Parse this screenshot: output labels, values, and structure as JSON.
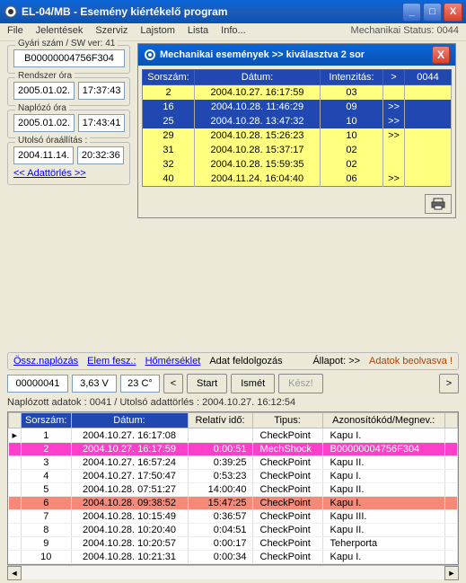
{
  "window": {
    "title": "EL-04/MB - Esemény kiértékelő program"
  },
  "menu": {
    "file": "File",
    "jelentesek": "Jelentések",
    "szerviz": "Szerviz",
    "lajstom": "Lajstom",
    "lista": "Lista",
    "info": "Info...",
    "status": "Mechanikai Status:  0044"
  },
  "left": {
    "gyari_legend": "Gyári szám / SW ver: 41",
    "gyari_value": "B00000004756F304",
    "rendszer_legend": "Rendszer óra",
    "rendszer_date": "2005.01.02.",
    "rendszer_time": "17:37:43",
    "naplozo_legend": "Naplózó óra",
    "naplozo_date": "2005.01.02.",
    "naplozo_time": "17:43:41",
    "utolso_legend": "Utolsó óraállítás :",
    "utolso_date": "2004.11.14.",
    "utolso_time": "20:32:36",
    "adattorles": "<< Adattörlés >>"
  },
  "popup": {
    "title": "Mechanikai események   >> kiválasztva 2 sor",
    "cols": {
      "sorszam": "Sorszám:",
      "datum": "Dátum:",
      "intenzitas": "Intenzitás:",
      "gt": ">",
      "code": "0044"
    },
    "rows": [
      {
        "s": "2",
        "d": "2004.10.27. 16:17:59",
        "i": "03",
        "g": ""
      },
      {
        "s": "16",
        "d": "2004.10.28. 11:46:29",
        "i": "09",
        "g": ">>"
      },
      {
        "s": "25",
        "d": "2004.10.28. 13:47:32",
        "i": "10",
        "g": ">>"
      },
      {
        "s": "29",
        "d": "2004.10.28. 15:26:23",
        "i": "10",
        "g": ">>"
      },
      {
        "s": "31",
        "d": "2004.10.28. 15:37:17",
        "i": "02",
        "g": ""
      },
      {
        "s": "32",
        "d": "2004.10.28. 15:59:35",
        "i": "02",
        "g": ""
      },
      {
        "s": "40",
        "d": "2004.11.24. 16:04:40",
        "i": "06",
        "g": ">>"
      }
    ]
  },
  "mid": {
    "osszn": "Össz.naplózás",
    "elemfesz": "Elem fesz.:",
    "homerseklet": "Hőmérséklet",
    "adatfeld": "Adat feldolgozás",
    "allapot": "Állapot: >>",
    "adatok": "Adatok beolvasva !"
  },
  "ctrl": {
    "v1": "00000041",
    "v2": "3,63 V",
    "v3": "23 C°",
    "lt": "<",
    "start": "Start",
    "ismet": "Ismét",
    "kesz": "Kész!",
    "gt": ">"
  },
  "status": "Naplózott adatok : 0041  /  Utolsó adattörlés : 2004.10.27. 16:12:54",
  "table": {
    "cols": {
      "empty": "",
      "sorszam": "Sorszám:",
      "datum": "Dátum:",
      "relativ": "Relatív idő:",
      "tipus": "Tipus:",
      "azon": "Azonosítókód/Megnev.:"
    },
    "rows": [
      {
        "s": "1",
        "d": "2004.10.27. 16:17:08",
        "r": "",
        "t": "CheckPoint",
        "a": "Kapu I."
      },
      {
        "s": "2",
        "d": "2004.10.27. 16:17:59",
        "r": "0:00:51",
        "t": "MechShock",
        "a": "B00000004756F304"
      },
      {
        "s": "3",
        "d": "2004.10.27. 16:57:24",
        "r": "0:39:25",
        "t": "CheckPoint",
        "a": "Kapu II."
      },
      {
        "s": "4",
        "d": "2004.10.27. 17:50:47",
        "r": "0:53:23",
        "t": "CheckPoint",
        "a": "Kapu I."
      },
      {
        "s": "5",
        "d": "2004.10.28. 07:51:27",
        "r": "14:00:40",
        "t": "CheckPoint",
        "a": "Kapu II."
      },
      {
        "s": "6",
        "d": "2004.10.28. 09:38:52",
        "r": "15:47:25",
        "t": "CheckPoint",
        "a": "Kapu I."
      },
      {
        "s": "7",
        "d": "2004.10.28. 10:15:49",
        "r": "0:36:57",
        "t": "CheckPoint",
        "a": "Kapu III."
      },
      {
        "s": "8",
        "d": "2004.10.28. 10:20:40",
        "r": "0:04:51",
        "t": "CheckPoint",
        "a": "Kapu II."
      },
      {
        "s": "9",
        "d": "2004.10.28. 10:20:57",
        "r": "0:00:17",
        "t": "CheckPoint",
        "a": "Teherporta"
      },
      {
        "s": "10",
        "d": "2004.10.28. 10:21:31",
        "r": "0:00:34",
        "t": "CheckPoint",
        "a": "Kapu I."
      }
    ]
  }
}
